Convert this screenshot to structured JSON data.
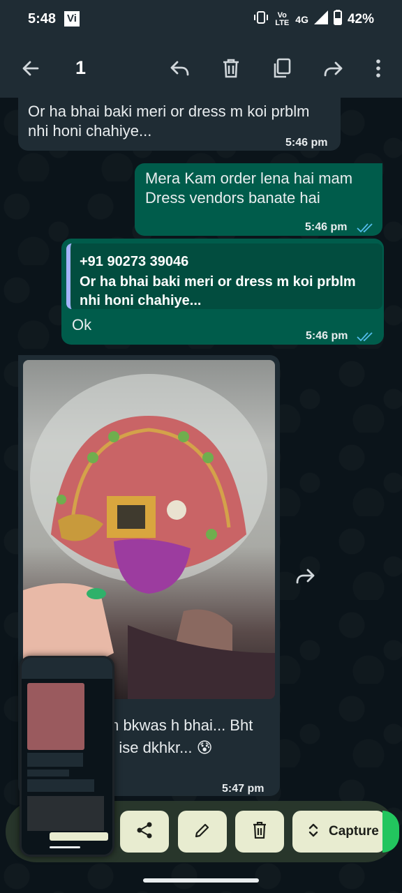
{
  "status_bar": {
    "time": "5:48",
    "carrier_badge": "Vi",
    "lte_label": "Vo LTE",
    "network": "4G",
    "battery": "42%"
  },
  "action_bar": {
    "selected_count": "1",
    "icons": [
      "back-arrow-icon",
      "reply-icon",
      "delete-icon",
      "copy-icon",
      "forward-icon",
      "more-vert-icon"
    ]
  },
  "messages": [
    {
      "direction": "incoming",
      "text_line1": "Or ha bhai baki meri or dress m koi prblm",
      "text_line2": "nhi honi chahiye...",
      "time": "5:46 pm"
    },
    {
      "direction": "outgoing",
      "text_line1": "Mera Kam order lena hai mam",
      "text_line2": "Dress vendors banate hai",
      "time": "5:46 pm"
    },
    {
      "direction": "outgoing",
      "quote_sender": "+91 90273 39046",
      "quote_line1": "Or ha bhai baki meri or dress m koi prblm",
      "quote_line2": "nhi honi chahiye...",
      "text": "Ok",
      "time": "5:46 pm"
    },
    {
      "direction": "incoming",
      "type": "image",
      "caption_line1": "m bkwas h bhai... Bht",
      "caption_line2": "n ise dkhkr... 😰",
      "time": "5:47 pm"
    }
  ],
  "bottom_toolbar": {
    "capture_label": "Capture",
    "icons": [
      "share-icon",
      "edit-icon",
      "delete-icon",
      "expand-icon"
    ]
  },
  "colors": {
    "header": "#1f2c34",
    "incoming_bubble": "#1f2c34",
    "outgoing_bubble": "#005c4b",
    "read_ticks": "#53bdeb",
    "toolbar_button": "#e8ecd0"
  }
}
